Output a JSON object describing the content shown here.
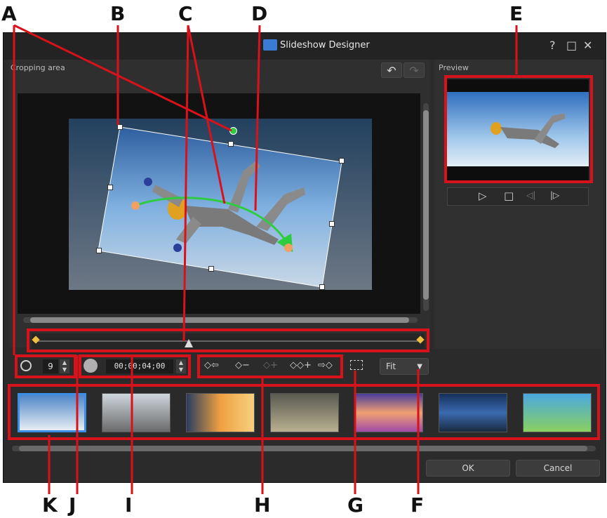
{
  "callouts": {
    "A": "A",
    "B": "B",
    "C": "C",
    "D": "D",
    "E": "E",
    "F": "F",
    "G": "G",
    "H": "H",
    "I": "I",
    "J": "J",
    "K": "K"
  },
  "window": {
    "title": "Slideshow Designer",
    "help": "?",
    "maximize": "□",
    "close": "✕"
  },
  "cropping": {
    "label": "Cropping area",
    "undo_icon": "↶",
    "redo_icon": "↷"
  },
  "preview": {
    "label": "Preview",
    "play": "▷",
    "stop": "□",
    "prev_frame": "◁|",
    "next_frame": "|▷"
  },
  "controls": {
    "rotation_value": "9",
    "time_value": "00;00;04;00",
    "kf_prev": "◇⇦",
    "kf_remove": "◇−",
    "kf_add_disabled": "◇+",
    "kf_duplicate": "◇◇+",
    "kf_next": "⇨◇",
    "fit_label": "Fit",
    "fit_arrow": "▼"
  },
  "footer": {
    "ok": "OK",
    "cancel": "Cancel"
  },
  "colors": {
    "accent_red": "#d8121a",
    "selection_blue": "#3a8ee6",
    "path_green": "#2ecc40"
  }
}
